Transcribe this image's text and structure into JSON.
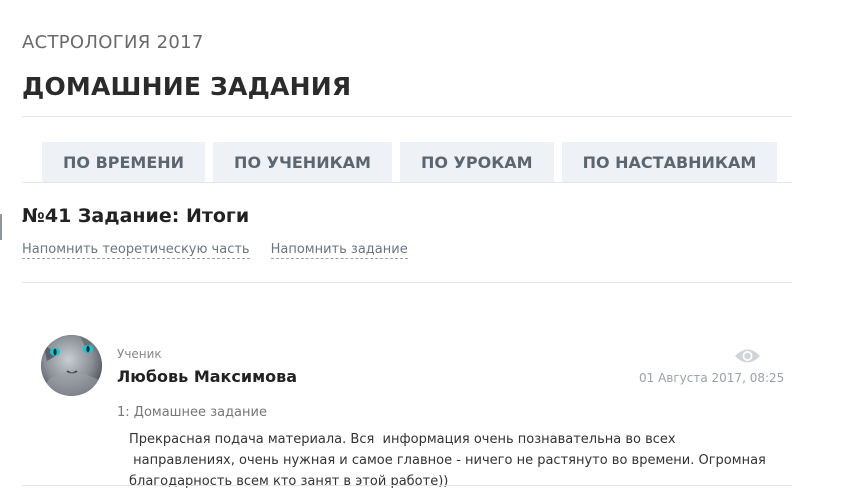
{
  "course_title": "АСТРОЛОГИЯ 2017",
  "page_title": "ДОМАШНИЕ ЗАДАНИЯ",
  "tabs": [
    {
      "label": "ПО ВРЕМЕНИ"
    },
    {
      "label": "ПО УЧЕНИКАМ"
    },
    {
      "label": "ПО УРОКАМ"
    },
    {
      "label": "ПО НАСТАВНИКАМ"
    }
  ],
  "task": {
    "title": "№41 Задание: Итоги",
    "links": {
      "theory": "Напомнить теоретическую часть",
      "task": "Напомнить задание"
    }
  },
  "submission": {
    "role": "Ученик",
    "student_name": "Любовь Максимова",
    "date": "01 Августа 2017, 08:25",
    "homework_label": "1: Домашнее задание",
    "answer_text": "Прекрасная подача материала. Вся  информация очень познавательна во всех\n направлениях, очень нужная и самое главное - ничего не растянуто во времени. Огромная\nблагодарность всем кто занят в этой работе))",
    "avatar_icon": "cat-avatar-icon",
    "view_icon": "eye-icon"
  },
  "colors": {
    "tab_bg": "#eef2f6",
    "tab_text": "#5c6670",
    "divider": "#e3e6ea"
  }
}
